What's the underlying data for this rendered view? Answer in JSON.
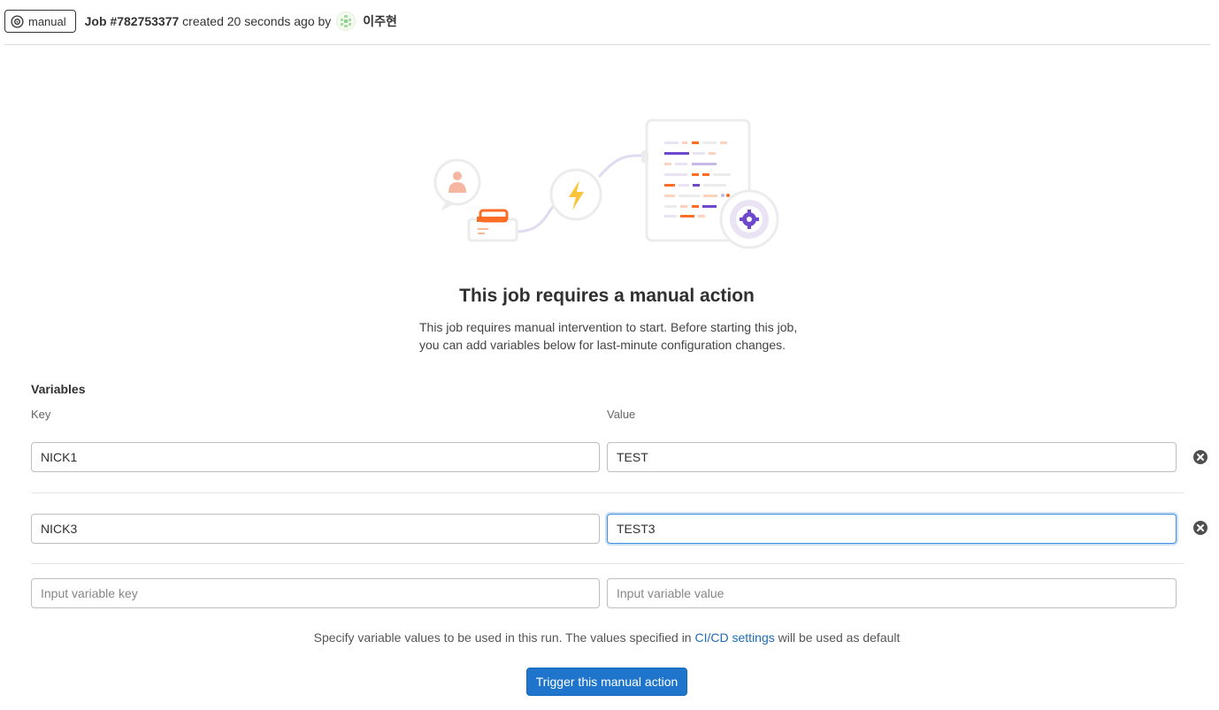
{
  "header": {
    "status_label": "manual",
    "job_label": "Job #782753377",
    "created_text": "created 20 seconds ago by",
    "username": "이주현"
  },
  "empty_state": {
    "title": "This job requires a manual action",
    "description_line1": "This job requires manual intervention to start. Before starting this job,",
    "description_line2": "you can add variables below for last-minute configuration changes."
  },
  "variables": {
    "heading": "Variables",
    "key_label": "Key",
    "value_label": "Value",
    "rows": [
      {
        "key": "NICK1",
        "value": "TEST"
      },
      {
        "key": "NICK3",
        "value": "TEST3"
      }
    ],
    "new_key_placeholder": "Input variable key",
    "new_value_placeholder": "Input variable value"
  },
  "helper": {
    "text_before": "Specify variable values to be used in this run. The values specified in ",
    "link_text": "CI/CD settings",
    "text_after": " will be used as default"
  },
  "trigger_button_label": "Trigger this manual action",
  "colors": {
    "primary": "#1f75cb",
    "focus_border": "#428fdc",
    "link": "#1f6bb8"
  }
}
